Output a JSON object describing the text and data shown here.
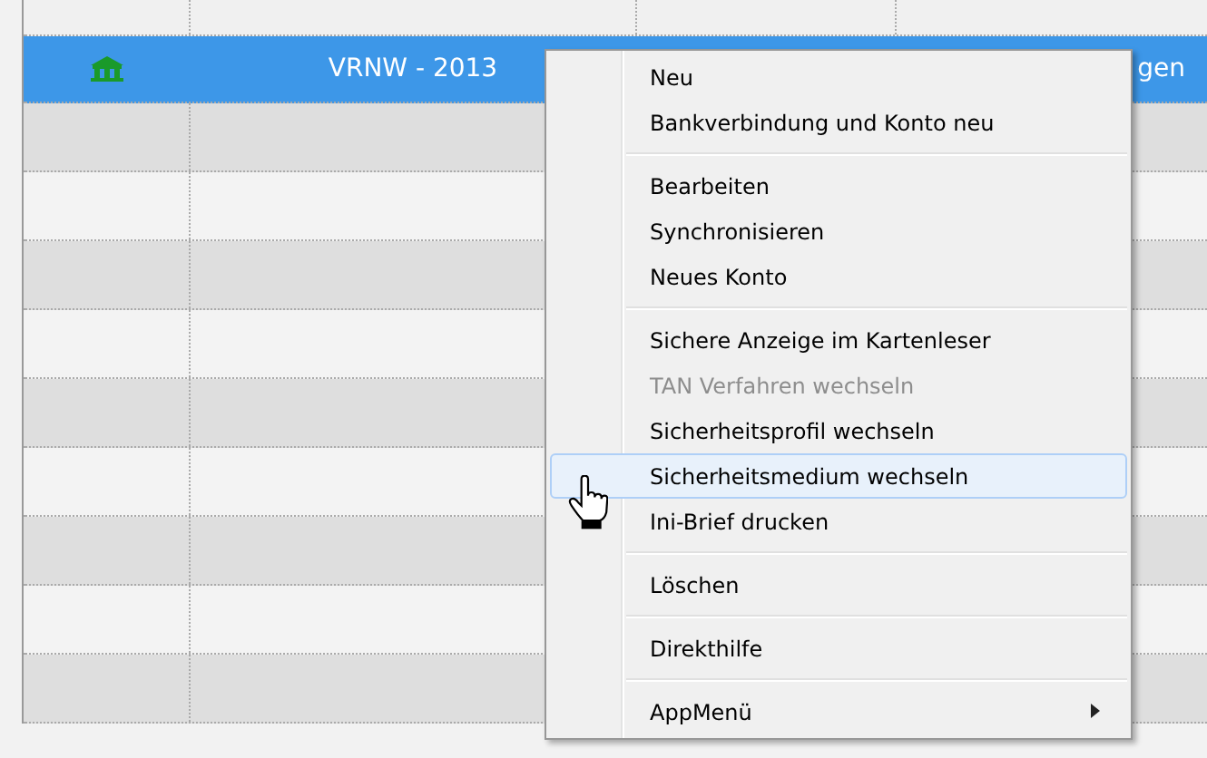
{
  "table": {
    "rows": [
      {
        "selected": true,
        "column_2": "VRNW - 2013",
        "column_4": "gen"
      },
      {
        "selected": false
      },
      {
        "selected": false
      },
      {
        "selected": false
      },
      {
        "selected": false
      },
      {
        "selected": false
      },
      {
        "selected": false
      },
      {
        "selected": false
      },
      {
        "selected": false
      },
      {
        "selected": false
      }
    ]
  },
  "context_menu": {
    "items": [
      {
        "kind": "item",
        "label": "Neu",
        "disabled": false,
        "selected": false
      },
      {
        "kind": "item",
        "label": "Bankverbindung und Konto neu",
        "disabled": false,
        "selected": false
      },
      {
        "kind": "separator"
      },
      {
        "kind": "item",
        "label": "Bearbeiten",
        "disabled": false,
        "selected": false
      },
      {
        "kind": "item",
        "label": "Synchronisieren",
        "disabled": false,
        "selected": false
      },
      {
        "kind": "item",
        "label": "Neues Konto",
        "disabled": false,
        "selected": false
      },
      {
        "kind": "separator"
      },
      {
        "kind": "item",
        "label": "Sichere Anzeige im Kartenleser",
        "disabled": false,
        "selected": false
      },
      {
        "kind": "item",
        "label": "TAN Verfahren wechseln",
        "disabled": true,
        "selected": false
      },
      {
        "kind": "item",
        "label": "Sicherheitsprofil wechseln",
        "disabled": false,
        "selected": false
      },
      {
        "kind": "item",
        "label": "Sicherheitsmedium wechseln",
        "disabled": false,
        "selected": true
      },
      {
        "kind": "item",
        "label": "Ini-Brief drucken",
        "disabled": false,
        "selected": false
      },
      {
        "kind": "separator"
      },
      {
        "kind": "item",
        "label": "Löschen",
        "disabled": false,
        "selected": false
      },
      {
        "kind": "separator"
      },
      {
        "kind": "item",
        "label": "Direkthilfe",
        "disabled": false,
        "selected": false
      },
      {
        "kind": "separator"
      },
      {
        "kind": "submenu",
        "label": "AppMenü",
        "disabled": false,
        "selected": false
      }
    ]
  }
}
